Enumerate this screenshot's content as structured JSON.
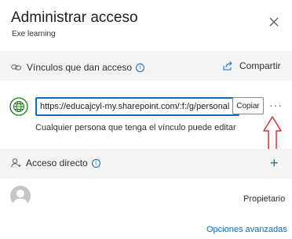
{
  "dialog": {
    "title": "Administrar acceso",
    "subtitle": "Exe learning"
  },
  "links_section": {
    "label": "Vínculos que dan acceso",
    "info_icon": "i",
    "share_label": "Compartir"
  },
  "link": {
    "url": "https://educajcyl-my.sharepoint.com/:f:/g/personal",
    "copy_label": "Copiar",
    "more_label": "···",
    "description": "Cualquier persona que tenga el vínculo puede editar"
  },
  "direct_section": {
    "label": "Acceso directo",
    "info_icon": "i",
    "add_label": "+"
  },
  "member": {
    "role": "Propietario"
  },
  "footer": {
    "advanced_label": "Opciones avanzadas"
  },
  "colors": {
    "accent": "#0f6cbd",
    "globe": "#107c10",
    "annotation_arrow": "#d13438"
  },
  "icons": [
    "close-icon",
    "link-icon",
    "info-icon",
    "share-icon",
    "globe-icon",
    "more-icon",
    "person-icon",
    "add-icon",
    "avatar-icon"
  ]
}
